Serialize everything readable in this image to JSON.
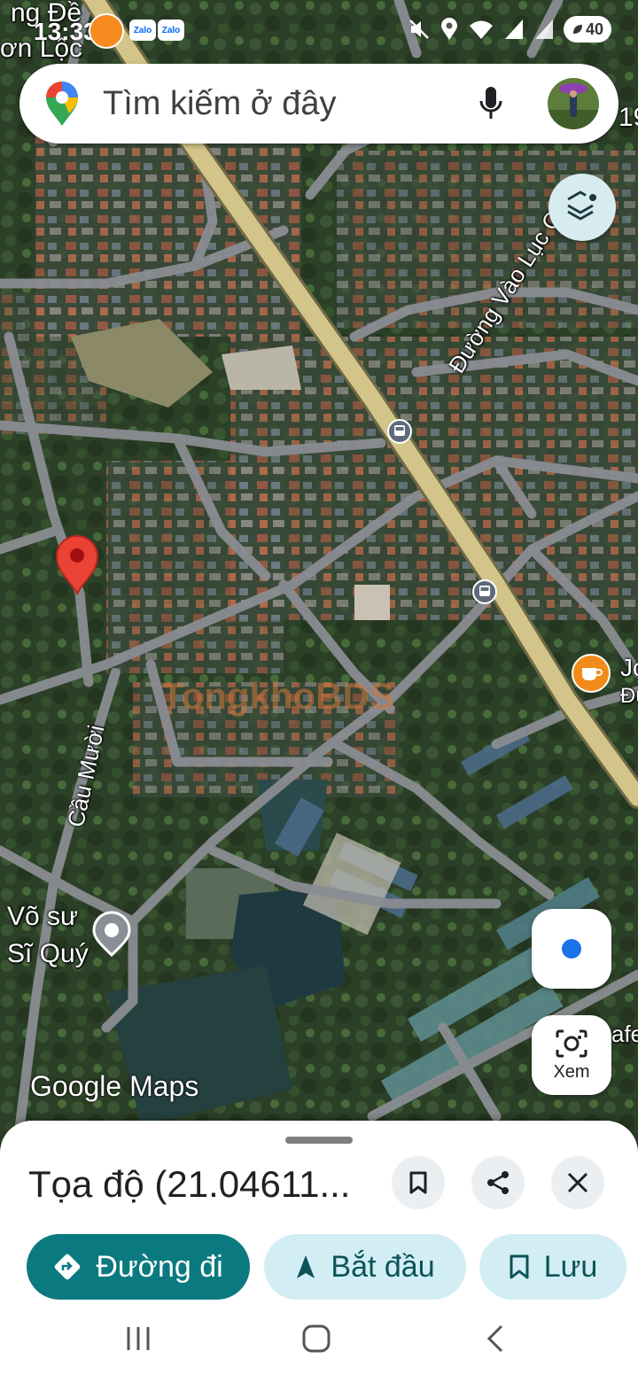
{
  "status_bar": {
    "time": "13:33",
    "apps": [
      "Zalo",
      "Zalo"
    ],
    "battery": "40"
  },
  "search": {
    "placeholder": "Tìm kiếm ở đây"
  },
  "map": {
    "labels": {
      "top_left_1": "ng Đề",
      "top_left_2": "ơn Lộc",
      "top_right": "19",
      "road": "Đường Vào Lục Quân",
      "street": "Cầu Mười",
      "poi_1": "Võ sư",
      "poi_2": "Sĩ Quý",
      "cafe_1": "Jc",
      "cafe_2": "Đư",
      "cafe_3": "afe",
      "watermark": "TongkhoBDS"
    },
    "logo": "Google Maps",
    "lens_label": "Xem"
  },
  "sheet": {
    "title": "Tọa độ (21.04611...",
    "buttons": {
      "directions": "Đường đi",
      "start": "Bắt đầu",
      "save": "Lưu"
    }
  },
  "colors": {
    "accent": "#0b7a80",
    "tonal": "#d2eef4",
    "pin": "#ea4335",
    "location_dot": "#1a73e8"
  }
}
